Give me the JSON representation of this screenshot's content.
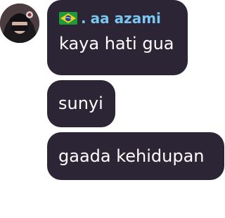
{
  "sender": {
    "flag_icon": "brazil-flag-icon",
    "prefix": ".",
    "name": "aa azami",
    "name_color": "#79c6f0"
  },
  "messages": [
    {
      "text": "kaya hati gua"
    },
    {
      "text": "sunyi"
    },
    {
      "text": "gaada kehidupan"
    }
  ],
  "colors": {
    "bubble": "#2b2535",
    "text": "#ffffff",
    "background": "#ffffff"
  }
}
